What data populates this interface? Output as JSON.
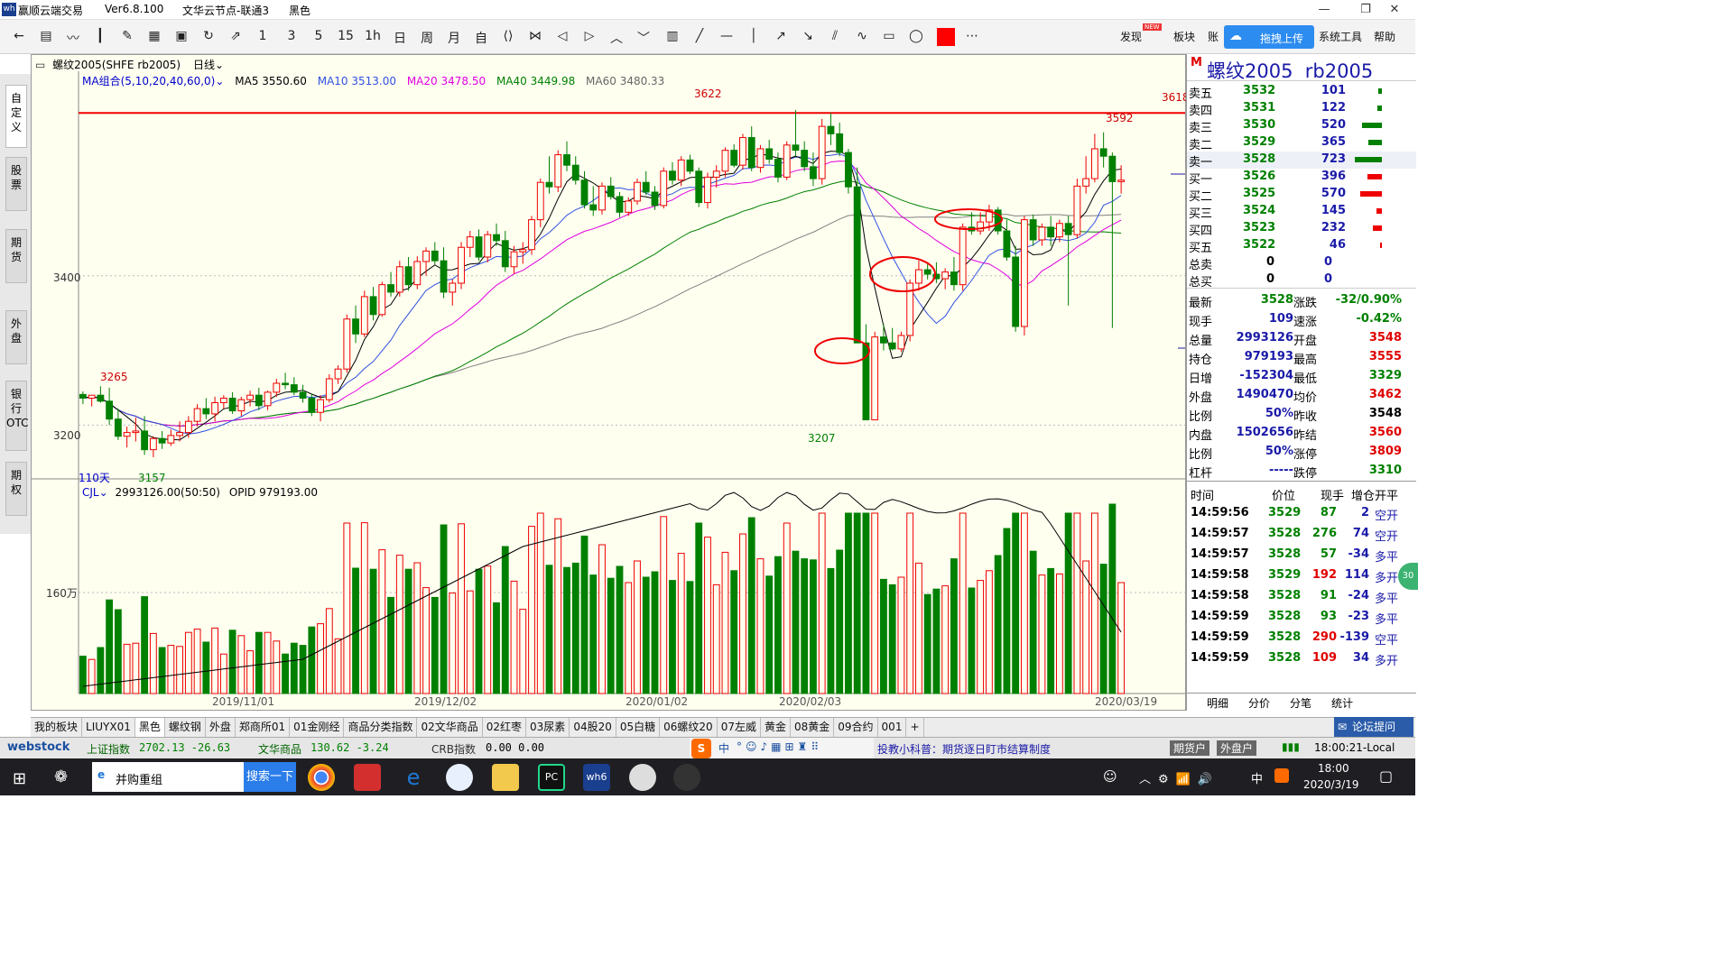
{
  "app": {
    "title": "赢顺云端交易",
    "version": "Ver6.8.100",
    "node": "文华云节点-联通3",
    "theme": "黑色"
  },
  "toolbar": {
    "icons": [
      "back-icon",
      "table-icon",
      "line-chart-icon",
      "candle-icon",
      "draw-icon",
      "grid-icon",
      "save-icon",
      "refresh-icon",
      "compare-icon"
    ],
    "periods": [
      "1",
      "3",
      "5",
      "15",
      "1h",
      "日",
      "周",
      "月"
    ],
    "right": {
      "discover": "发现",
      "badge": "NEW",
      "sector": "板块",
      "account": "账",
      "upload": "拖拽上传",
      "system": "系统工具",
      "help": "帮助"
    }
  },
  "sidebar": [
    "自定义",
    "股票",
    "期货",
    "外盘",
    "银行OTC",
    "期权"
  ],
  "chart": {
    "symbol": "螺纹2005(SHFE rb2005)",
    "period": "日线",
    "ma_group": "MA组合(5,10,20,40,60,0)",
    "ma5": "MA5 3550.60",
    "ma10": "MA10 3513.00",
    "ma20": "MA20 3478.50",
    "ma40": "MA40 3449.98",
    "ma60": "MA60 3480.33",
    "days": "110天",
    "high_label": "3622",
    "right_high_label": "3592",
    "low_label": "3207",
    "left_low_label": "3157",
    "left_label": "3265",
    "line_label": "3618",
    "y_labels": [
      "3400",
      "3200"
    ],
    "vol_title": "CJL",
    "vol_value": "2993126.00(50:50)",
    "opid": "OPID 979193.00",
    "vol_ylabel": "160万",
    "dates": [
      "2019/11/01",
      "2019/12/02",
      "2020/01/02",
      "2020/02/03",
      "2020/03/19"
    ]
  },
  "chart_data": {
    "type": "candlestick",
    "ylim": [
      3140,
      3640
    ],
    "hline": 3618,
    "candles": [
      [
        3241,
        3245,
        3228,
        3236
      ],
      [
        3236,
        3240,
        3225,
        3240
      ],
      [
        3240,
        3252,
        3230,
        3232
      ],
      [
        3232,
        3250,
        3200,
        3208
      ],
      [
        3208,
        3222,
        3180,
        3185
      ],
      [
        3185,
        3198,
        3170,
        3190
      ],
      [
        3190,
        3210,
        3178,
        3192
      ],
      [
        3192,
        3212,
        3160,
        3167
      ],
      [
        3167,
        3185,
        3157,
        3182
      ],
      [
        3182,
        3192,
        3168,
        3176
      ],
      [
        3176,
        3194,
        3172,
        3186
      ],
      [
        3186,
        3205,
        3178,
        3190
      ],
      [
        3190,
        3212,
        3183,
        3205
      ],
      [
        3205,
        3228,
        3198,
        3222
      ],
      [
        3222,
        3236,
        3208,
        3215
      ],
      [
        3215,
        3238,
        3205,
        3230
      ],
      [
        3230,
        3240,
        3222,
        3236
      ],
      [
        3236,
        3244,
        3215,
        3219
      ],
      [
        3219,
        3238,
        3212,
        3234
      ],
      [
        3234,
        3246,
        3225,
        3240
      ],
      [
        3240,
        3250,
        3220,
        3226
      ],
      [
        3226,
        3246,
        3220,
        3244
      ],
      [
        3244,
        3262,
        3238,
        3256
      ],
      [
        3256,
        3270,
        3248,
        3254
      ],
      [
        3254,
        3264,
        3240,
        3244
      ],
      [
        3244,
        3254,
        3230,
        3236
      ],
      [
        3236,
        3242,
        3212,
        3217
      ],
      [
        3217,
        3240,
        3205,
        3234
      ],
      [
        3234,
        3268,
        3230,
        3262
      ],
      [
        3262,
        3280,
        3255,
        3275
      ],
      [
        3275,
        3348,
        3270,
        3342
      ],
      [
        3342,
        3360,
        3310,
        3322
      ],
      [
        3322,
        3380,
        3318,
        3372
      ],
      [
        3372,
        3385,
        3340,
        3348
      ],
      [
        3348,
        3392,
        3345,
        3388
      ],
      [
        3388,
        3405,
        3372,
        3378
      ],
      [
        3378,
        3420,
        3372,
        3412
      ],
      [
        3412,
        3425,
        3380,
        3388
      ],
      [
        3388,
        3426,
        3382,
        3419
      ],
      [
        3419,
        3438,
        3400,
        3433
      ],
      [
        3433,
        3445,
        3415,
        3420
      ],
      [
        3420,
        3438,
        3370,
        3378
      ],
      [
        3378,
        3395,
        3360,
        3390
      ],
      [
        3390,
        3445,
        3382,
        3438
      ],
      [
        3438,
        3460,
        3425,
        3452
      ],
      [
        3452,
        3462,
        3420,
        3425
      ],
      [
        3425,
        3460,
        3418,
        3455
      ],
      [
        3455,
        3470,
        3440,
        3447
      ],
      [
        3447,
        3460,
        3405,
        3412
      ],
      [
        3412,
        3440,
        3402,
        3432
      ],
      [
        3432,
        3445,
        3416,
        3435
      ],
      [
        3435,
        3480,
        3428,
        3475
      ],
      [
        3475,
        3530,
        3465,
        3525
      ],
      [
        3525,
        3560,
        3510,
        3519
      ],
      [
        3519,
        3568,
        3512,
        3562
      ],
      [
        3562,
        3580,
        3540,
        3548
      ],
      [
        3548,
        3560,
        3522,
        3528
      ],
      [
        3528,
        3540,
        3490,
        3495
      ],
      [
        3495,
        3520,
        3480,
        3488
      ],
      [
        3488,
        3525,
        3482,
        3520
      ],
      [
        3520,
        3532,
        3502,
        3506
      ],
      [
        3506,
        3512,
        3478,
        3485
      ],
      [
        3485,
        3505,
        3480,
        3500
      ],
      [
        3500,
        3530,
        3495,
        3525
      ],
      [
        3525,
        3540,
        3508,
        3512
      ],
      [
        3512,
        3520,
        3488,
        3494
      ],
      [
        3494,
        3545,
        3490,
        3540
      ],
      [
        3540,
        3552,
        3522,
        3528
      ],
      [
        3528,
        3560,
        3520,
        3555
      ],
      [
        3555,
        3562,
        3536,
        3540
      ],
      [
        3540,
        3545,
        3492,
        3498
      ],
      [
        3498,
        3538,
        3490,
        3532
      ],
      [
        3532,
        3548,
        3518,
        3540
      ],
      [
        3540,
        3572,
        3532,
        3568
      ],
      [
        3568,
        3576,
        3545,
        3548
      ],
      [
        3548,
        3590,
        3542,
        3585
      ],
      [
        3585,
        3600,
        3540,
        3545
      ],
      [
        3545,
        3575,
        3538,
        3570
      ],
      [
        3570,
        3582,
        3550,
        3556
      ],
      [
        3556,
        3565,
        3525,
        3532
      ],
      [
        3532,
        3580,
        3528,
        3575
      ],
      [
        3575,
        3622,
        3560,
        3568
      ],
      [
        3568,
        3580,
        3540,
        3546
      ],
      [
        3546,
        3565,
        3520,
        3530
      ],
      [
        3530,
        3610,
        3522,
        3600
      ],
      [
        3600,
        3618,
        3575,
        3590
      ],
      [
        3590,
        3605,
        3560,
        3565
      ],
      [
        3565,
        3570,
        3510,
        3519
      ],
      [
        3519,
        3545,
        3475,
        3310
      ],
      [
        3310,
        3335,
        3230,
        3207
      ],
      [
        3207,
        3325,
        3207,
        3318
      ],
      [
        3318,
        3335,
        3300,
        3310
      ],
      [
        3310,
        3330,
        3300,
        3302
      ],
      [
        3302,
        3325,
        3298,
        3320
      ],
      [
        3320,
        3395,
        3312,
        3390
      ],
      [
        3390,
        3420,
        3380,
        3408
      ],
      [
        3408,
        3418,
        3395,
        3402
      ],
      [
        3402,
        3418,
        3390,
        3396
      ],
      [
        3396,
        3410,
        3382,
        3405
      ],
      [
        3405,
        3425,
        3380,
        3388
      ],
      [
        3388,
        3470,
        3380,
        3465
      ],
      [
        3465,
        3485,
        3455,
        3460
      ],
      [
        3460,
        3485,
        3455,
        3472
      ],
      [
        3472,
        3495,
        3460,
        3488
      ],
      [
        3488,
        3492,
        3455,
        3460
      ],
      [
        3460,
        3475,
        3420,
        3425
      ],
      [
        3425,
        3440,
        3325,
        3332
      ],
      [
        3332,
        3480,
        3320,
        3475
      ],
      [
        3475,
        3482,
        3440,
        3448
      ],
      [
        3448,
        3470,
        3440,
        3465
      ],
      [
        3465,
        3480,
        3440,
        3452
      ],
      [
        3452,
        3475,
        3445,
        3470
      ],
      [
        3470,
        3480,
        3360,
        3455
      ],
      [
        3455,
        3530,
        3450,
        3520
      ],
      [
        3520,
        3560,
        3510,
        3530
      ],
      [
        3530,
        3590,
        3525,
        3570
      ],
      [
        3570,
        3592,
        3545,
        3560
      ],
      [
        3560,
        3565,
        3330,
        3526
      ],
      [
        3526,
        3548,
        3510,
        3528
      ]
    ],
    "volume_bars": "per candle"
  },
  "orderbook": {
    "title": "螺纹2005  rb2005",
    "asks": [
      {
        "label": "卖五",
        "price": "3532",
        "vol": "101"
      },
      {
        "label": "卖四",
        "price": "3531",
        "vol": "122"
      },
      {
        "label": "卖三",
        "price": "3530",
        "vol": "520"
      },
      {
        "label": "卖二",
        "price": "3529",
        "vol": "365"
      },
      {
        "label": "卖一",
        "price": "3528",
        "vol": "723"
      }
    ],
    "bids": [
      {
        "label": "买一",
        "price": "3526",
        "vol": "396"
      },
      {
        "label": "买二",
        "price": "3525",
        "vol": "570"
      },
      {
        "label": "买三",
        "price": "3524",
        "vol": "145"
      },
      {
        "label": "买四",
        "price": "3523",
        "vol": "232"
      },
      {
        "label": "买五",
        "price": "3522",
        "vol": "46"
      }
    ],
    "total_sell": {
      "label": "总卖",
      "a": "0",
      "b": "0"
    },
    "total_buy": {
      "label": "总买",
      "a": "0",
      "b": "0"
    }
  },
  "quote": [
    [
      "最新",
      "3528",
      "涨跌",
      "-32/0.90%"
    ],
    [
      "现手",
      "109",
      "速涨",
      "-0.42%"
    ],
    [
      "总量",
      "2993126",
      "开盘",
      "3548"
    ],
    [
      "持仓",
      "979193",
      "最高",
      "3555"
    ],
    [
      "日增",
      "-152304",
      "最低",
      "3329"
    ],
    [
      "外盘",
      "1490470",
      "均价",
      "3462"
    ],
    [
      "比例",
      "50%",
      "昨收",
      "3548"
    ],
    [
      "内盘",
      "1502656",
      "昨结",
      "3560"
    ],
    [
      "比例",
      "50%",
      "涨停",
      "3809"
    ],
    [
      "杠杆",
      "-----",
      "跌停",
      "3310"
    ]
  ],
  "ticks": {
    "headers": [
      "时间",
      "价位",
      "现手",
      "增仓",
      "开平"
    ],
    "rows": [
      [
        "14:59:56",
        "3529",
        "87",
        "2",
        "空开"
      ],
      [
        "14:59:57",
        "3528",
        "276",
        "74",
        "空开"
      ],
      [
        "14:59:57",
        "3528",
        "57",
        "-34",
        "多平"
      ],
      [
        "14:59:58",
        "3529",
        "192",
        "114",
        "多开"
      ],
      [
        "14:59:58",
        "3528",
        "91",
        "-24",
        "多平"
      ],
      [
        "14:59:59",
        "3528",
        "93",
        "-23",
        "多平"
      ],
      [
        "14:59:59",
        "3528",
        "290",
        "-139",
        "空平"
      ],
      [
        "14:59:59",
        "3528",
        "109",
        "34",
        "多开"
      ]
    ],
    "tabs": [
      "明细",
      "分价",
      "分笔",
      "统计"
    ],
    "badge": "30"
  },
  "bottom_tabs": [
    "我的板块",
    "LIUYX01",
    "黑色",
    "螺纹钢",
    "外盘",
    "郑商所01",
    "01金刚经",
    "商品分类指数",
    "02文华商品",
    "02红枣",
    "03尿素",
    "04股20",
    "05白糖",
    "06螺纹20",
    "07左威",
    "黄金",
    "08黄金",
    "09合约",
    "001",
    "+"
  ],
  "status": {
    "logo": "webstock",
    "sh_label": "上证指数",
    "sh_val": "2702.13 -26.63",
    "wh_label": "文华商品",
    "wh_val": "130.62 -3.24",
    "crb_label": "CRB指数",
    "crb_val": "0.00 0.00",
    "news": "投教小科普：期货逐日盯市结算制度",
    "futures": "期货户",
    "foreign": "外盘户",
    "clock": "18:00:21-Local",
    "forum": "论坛提问"
  },
  "taskbar": {
    "search": "并购重组",
    "search_btn": "搜索一下",
    "time": "18:00",
    "date": "2020/3/19",
    "ime": "中"
  }
}
